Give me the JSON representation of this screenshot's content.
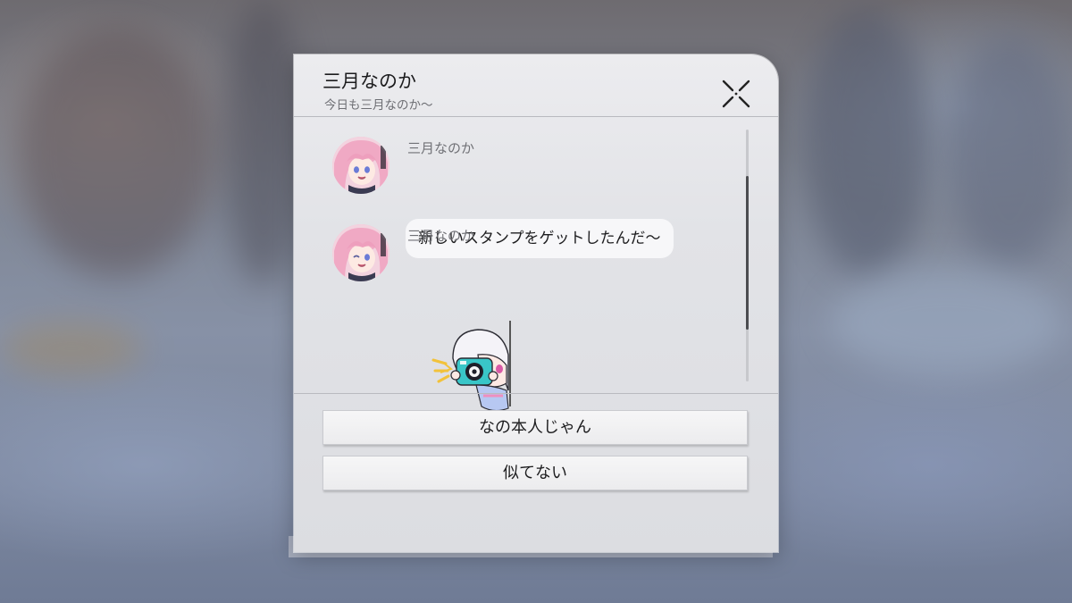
{
  "dialog": {
    "title": "三月なのか",
    "subtitle": "今日も三月なのか〜"
  },
  "messages": [
    {
      "sender": "三月なのか",
      "type": "text",
      "text": "新しいスタンプをゲットしたんだ〜"
    },
    {
      "sender": "三月なのか",
      "type": "sticker",
      "sticker": "camera-peek-sticker"
    }
  ],
  "options": [
    {
      "label": "なの本人じゃん"
    },
    {
      "label": "似てない"
    }
  ],
  "icons": {
    "close": "close-icon",
    "avatar": "character-avatar",
    "sticker": "camera-peek-sticker"
  },
  "colors": {
    "panel": "#e3e4e8",
    "bubble": "#f7f7f9",
    "scroll_thumb": "#4b4c50"
  }
}
